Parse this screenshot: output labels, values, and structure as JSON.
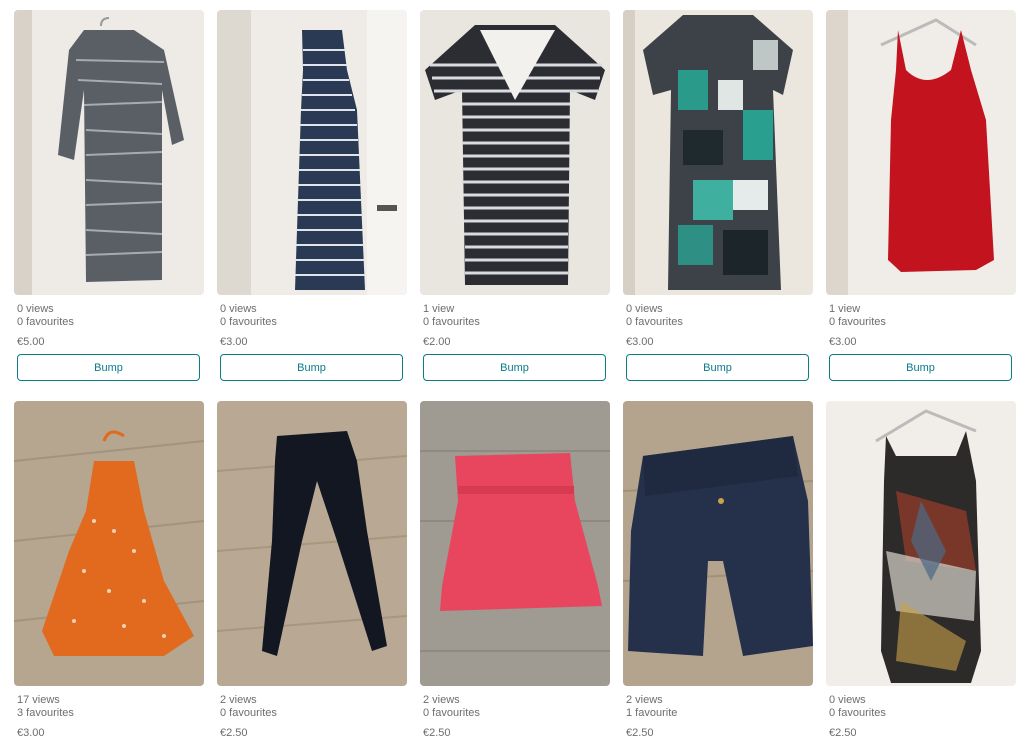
{
  "bump_label": "Bump",
  "items": [
    {
      "image": "gray-striped-wrap-dress",
      "views": "0 views",
      "favourites": "0 favourites",
      "price": "€5.00"
    },
    {
      "image": "navy-striped-maxi-tank-dress",
      "views": "0 views",
      "favourites": "0 favourites",
      "price": "€3.00"
    },
    {
      "image": "striped-nursing-tshirt",
      "views": "1 view",
      "favourites": "0 favourites",
      "price": "€2.00"
    },
    {
      "image": "teal-patterned-dress",
      "views": "0 views",
      "favourites": "0 favourites",
      "price": "€3.00"
    },
    {
      "image": "red-tank-dress",
      "views": "1 view",
      "favourites": "0 favourites",
      "price": "€3.00"
    },
    {
      "image": "orange-polka-dot-halter-dress",
      "views": "17 views",
      "favourites": "3 favourites",
      "price": "€3.00"
    },
    {
      "image": "black-maternity-leggings",
      "views": "2 views",
      "favourites": "0 favourites",
      "price": "€2.50"
    },
    {
      "image": "pink-maternity-skirt",
      "views": "2 views",
      "favourites": "0 favourites",
      "price": "€2.50"
    },
    {
      "image": "navy-maternity-shorts",
      "views": "2 views",
      "favourites": "1 favourite",
      "price": "€2.50"
    },
    {
      "image": "abstract-print-tank-top",
      "views": "0 views",
      "favourites": "0 favourites",
      "price": "€2.50"
    }
  ]
}
